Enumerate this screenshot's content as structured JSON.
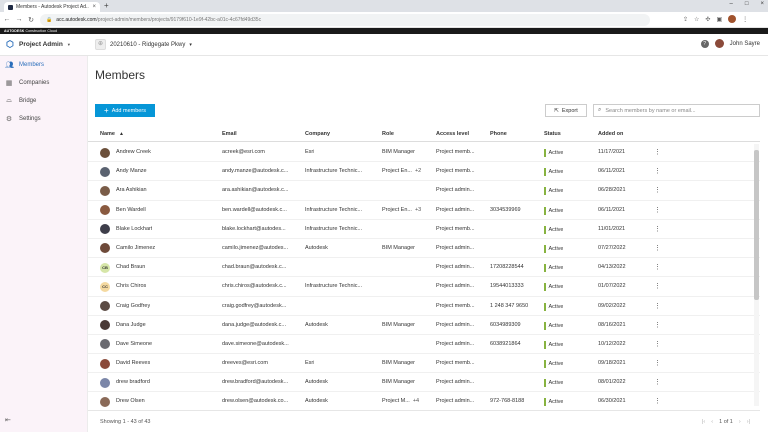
{
  "browser": {
    "tab_title": "Members - Autodesk Project Ad...",
    "tab_close": "×",
    "new_tab": "+",
    "url_host": "acc.autodesk.com",
    "url_path": "/project-admin/members/projects/9179f610-1e9f-42bc-a01c-4c67fd49d35c",
    "brand_strip_a": "AUTODESK",
    "brand_strip_b": " Construction Cloud"
  },
  "header": {
    "module_label": "Project Admin",
    "project_name": "20210610 - Ridgegate Pkwy",
    "help_label": "?",
    "user_name": "John Sayre"
  },
  "sidebar": {
    "items": [
      {
        "label": "Members",
        "icon": "people-icon"
      },
      {
        "label": "Companies",
        "icon": "building-icon"
      },
      {
        "label": "Bridge",
        "icon": "bridge-icon"
      },
      {
        "label": "Settings",
        "icon": "gear-icon"
      }
    ]
  },
  "main": {
    "title": "Members",
    "add_button": "Add members",
    "export_button": "Export",
    "search_placeholder": "Search members by name or email...",
    "columns": {
      "name": "Name",
      "email": "Email",
      "company": "Company",
      "role": "Role",
      "access": "Access level",
      "phone": "Phone",
      "status": "Status",
      "added": "Added on"
    },
    "rows": [
      {
        "name": "Andrew Creek",
        "email": "acreek@esri.com",
        "company": "Esri",
        "role": "BIM Manager",
        "role_extra": "",
        "access": "Project memb...",
        "phone": "",
        "status": "Active",
        "added": "11/17/2021",
        "avatar": "#6b4f3a",
        "init": ""
      },
      {
        "name": "Andy Manze",
        "email": "andy.manze@autodesk.c...",
        "company": "Infrastructure Technic...",
        "role": "Project En...",
        "role_extra": "+2",
        "access": "Project memb...",
        "phone": "",
        "status": "Active",
        "added": "06/11/2021",
        "avatar": "#5a6270",
        "init": ""
      },
      {
        "name": "Ara Ashikian",
        "email": "ara.ashikian@autodesk.c...",
        "company": "",
        "role": "",
        "role_extra": "",
        "access": "Project admin...",
        "phone": "",
        "status": "Active",
        "added": "06/28/2021",
        "avatar": "#7a5c48",
        "init": ""
      },
      {
        "name": "Ben Wardell",
        "email": "ben.wardell@autodesk.c...",
        "company": "Infrastructure Technic...",
        "role": "Project En...",
        "role_extra": "+3",
        "access": "Project admin...",
        "phone": "3034539969",
        "status": "Active",
        "added": "06/11/2021",
        "avatar": "#8a5a40",
        "init": ""
      },
      {
        "name": "Blake Lockhart",
        "email": "blake.lockhart@autodes...",
        "company": "Infrastructure Technic...",
        "role": "",
        "role_extra": "",
        "access": "Project memb...",
        "phone": "",
        "status": "Active",
        "added": "11/01/2021",
        "avatar": "#3e3e4a",
        "init": ""
      },
      {
        "name": "Camilo Jimenez",
        "email": "camilo.jimenez@autodes...",
        "company": "Autodesk",
        "role": "BIM Manager",
        "role_extra": "",
        "access": "Project admin...",
        "phone": "",
        "status": "Active",
        "added": "07/27/2022",
        "avatar": "#6e4a3a",
        "init": ""
      },
      {
        "name": "Chad Braun",
        "email": "chad.braun@autodesk.c...",
        "company": "",
        "role": "",
        "role_extra": "",
        "access": "Project admin...",
        "phone": "17208228544",
        "status": "Active",
        "added": "04/13/2022",
        "avatar": "#d6e6a8",
        "init": "CB"
      },
      {
        "name": "Chris Chiros",
        "email": "chris.chiros@autodesk.c...",
        "company": "Infrastructure Technic...",
        "role": "",
        "role_extra": "",
        "access": "Project admin...",
        "phone": "19544013333",
        "status": "Active",
        "added": "01/07/2022",
        "avatar": "#f4d9a0",
        "init": "CC"
      },
      {
        "name": "Craig Godfrey",
        "email": "craig.godfrey@autodesk...",
        "company": "",
        "role": "",
        "role_extra": "",
        "access": "Project memb...",
        "phone": "1 248 347 9650",
        "status": "Active",
        "added": "09/02/2022",
        "avatar": "#5b4b44",
        "init": ""
      },
      {
        "name": "Dana Judge",
        "email": "dana.judge@autodesk.c...",
        "company": "Autodesk",
        "role": "BIM Manager",
        "role_extra": "",
        "access": "Project admin...",
        "phone": "6034989309",
        "status": "Active",
        "added": "08/16/2021",
        "avatar": "#4a3a36",
        "init": ""
      },
      {
        "name": "Dave Simeone",
        "email": "dave.simeone@autodesk...",
        "company": "",
        "role": "",
        "role_extra": "",
        "access": "Project admin...",
        "phone": "6038921864",
        "status": "Active",
        "added": "10/12/2022",
        "avatar": "#6a6a70",
        "init": ""
      },
      {
        "name": "David Reeves",
        "email": "dreeves@esri.com",
        "company": "Esri",
        "role": "BIM Manager",
        "role_extra": "",
        "access": "Project memb...",
        "phone": "",
        "status": "Active",
        "added": "09/18/2021",
        "avatar": "#8a4a3a",
        "init": ""
      },
      {
        "name": "drew bradford",
        "email": "drew.bradford@autodesk...",
        "company": "Autodesk",
        "role": "BIM Manager",
        "role_extra": "",
        "access": "Project admin...",
        "phone": "",
        "status": "Active",
        "added": "08/01/2022",
        "avatar": "#7b86a8",
        "init": ""
      },
      {
        "name": "Drew Olsen",
        "email": "drew.olsen@autodesk.co...",
        "company": "Autodesk",
        "role": "Project M...",
        "role_extra": "+4",
        "access": "Project admin...",
        "phone": "972-768-8188",
        "status": "Active",
        "added": "06/30/2021",
        "avatar": "#8a6a58",
        "init": ""
      }
    ],
    "showing": "Showing 1 - 43 of 43",
    "page_label": "1 of 1",
    "colors": {
      "accent": "#0696d7",
      "status_active": "#87b340",
      "sidebar_bg": "#fbf3f9"
    }
  }
}
